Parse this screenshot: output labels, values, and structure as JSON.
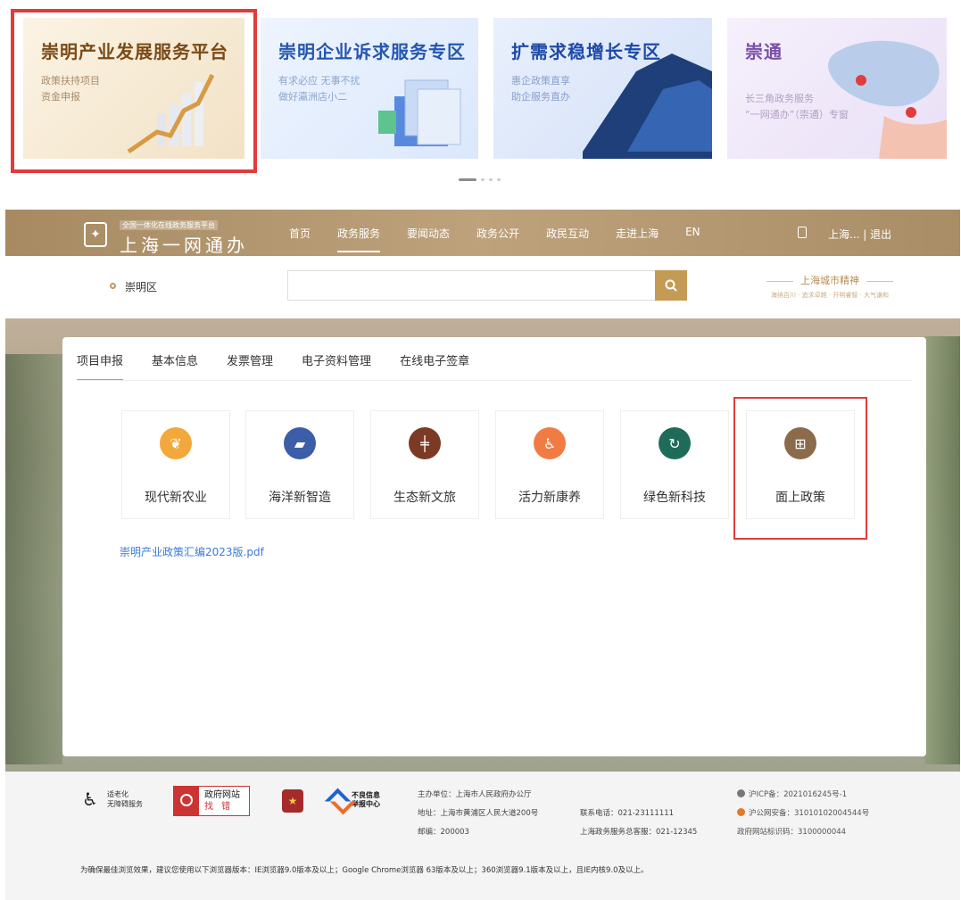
{
  "banners": [
    {
      "title": "崇明产业发展服务平台",
      "sub1": "政策扶持项目",
      "sub2": "资金申报"
    },
    {
      "title": "崇明企业诉求服务专区",
      "sub1": "有求必应 无事不扰",
      "sub2": "做好瀛洲店小二"
    },
    {
      "title": "扩需求稳增长专区",
      "sub1": "惠企政策直享",
      "sub2": "助企服务直办"
    },
    {
      "title": "崇通",
      "sub1": "长三角政务服务",
      "sub2": "“一网通办”（崇通）专窗"
    }
  ],
  "header": {
    "logo_small": "全国一体化在线政务服务平台",
    "logo_text": "上海一网通办",
    "nav": [
      "首页",
      "政务服务",
      "要闻动态",
      "政务公开",
      "政民互动",
      "走进上海",
      "EN"
    ],
    "user_text": "上海... | 退出"
  },
  "search": {
    "location": "崇明区",
    "value": "",
    "spirit_title": "上海城市精神",
    "spirit_sub": "海纳百川 · 追求卓越 · 开明睿智 · 大气谦和"
  },
  "tabs": [
    "项目申报",
    "基本信息",
    "发票管理",
    "电子资料管理",
    "在线电子签章"
  ],
  "tiles": [
    {
      "label": "现代新农业",
      "color": "#f2a83a",
      "glyph": "❦"
    },
    {
      "label": "海洋新智造",
      "color": "#3c5da8",
      "glyph": "▰"
    },
    {
      "label": "生态新文旅",
      "color": "#7b3a24",
      "glyph": "╪"
    },
    {
      "label": "活力新康养",
      "color": "#f07c43",
      "glyph": "♿"
    },
    {
      "label": "绿色新科技",
      "color": "#1f6b5a",
      "glyph": "↻"
    },
    {
      "label": "面上政策",
      "color": "#8c6b4a",
      "glyph": "⊞"
    }
  ],
  "pdf_link": "崇明产业政策汇编2023版.pdf",
  "footer": {
    "access1": "适老化",
    "access2": "无障碍服务",
    "find1": "政府网站",
    "find2": "找 错",
    "report1": "不良信息",
    "report2": "举报中心",
    "host": "主办单位：上海市人民政府办公厅",
    "address": "地址：上海市黄浦区人民大道200号",
    "postcode": "邮编：200003",
    "phone": "联系电话：021-23111111",
    "hotline": "上海政务服务总客服：021-12345",
    "icp": "沪ICP备：2021016245号-1",
    "police": "沪公网安备：31010102004544号",
    "site_id": "政府网站标识码：3100000044",
    "note": "为确保最佳浏览效果，建议您使用以下浏览器版本：IE浏览器9.0版本及以上；Google Chrome浏览器 63版本及以上；360浏览器9.1版本及以上，且IE内核9.0及以上。"
  }
}
